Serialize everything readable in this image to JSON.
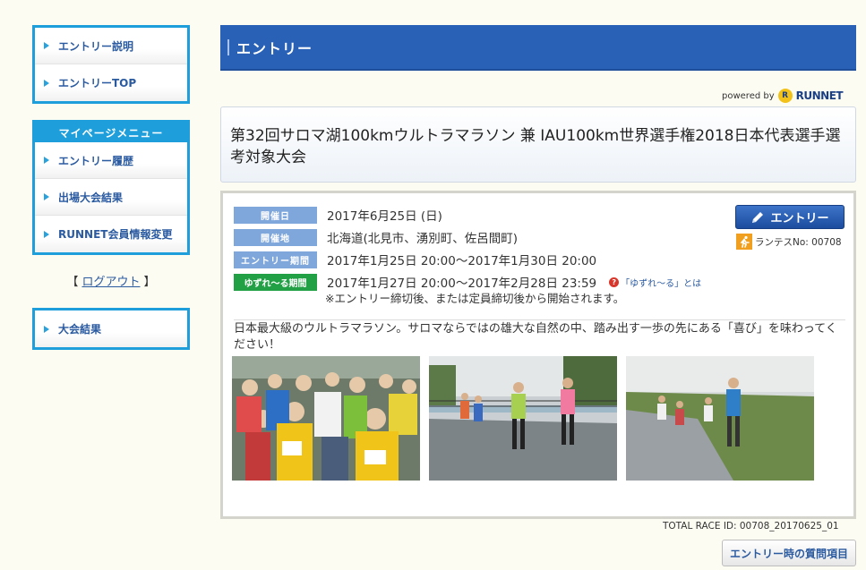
{
  "sidebar": {
    "entry_box": {
      "items": [
        {
          "label": "エントリー説明"
        },
        {
          "label": "エントリーTOP"
        }
      ]
    },
    "mypage_box": {
      "heading": "マイページメニュー",
      "items": [
        {
          "label": "エントリー履歴"
        },
        {
          "label": "出場大会結果"
        },
        {
          "label": "RUNNET会員情報変更"
        }
      ]
    },
    "logout": {
      "open": "【",
      "label": "ログアウト",
      "close": "】"
    },
    "results_box": {
      "items": [
        {
          "label": "大会結果"
        }
      ]
    }
  },
  "header": {
    "title": "エントリー"
  },
  "powered": {
    "prefix": "powered by",
    "brand": "RUNNET"
  },
  "race": {
    "title": "第32回サロマ湖100kmウルトラマラソン 兼 IAU100km世界選手権2018日本代表選手選考対象大会"
  },
  "info": {
    "rows": [
      {
        "badge": "開催日",
        "value": "2017年6月25日 (日)"
      },
      {
        "badge": "開催地",
        "value": "北海道(北見市、湧別町、佐呂間町)"
      },
      {
        "badge": "エントリー期間",
        "value": "2017年1月25日 20:00〜2017年1月30日 20:00"
      },
      {
        "badge": "ゆずれ〜る期間",
        "value": "2017年1月27日 20:00〜2017年2月28日 23:59"
      }
    ],
    "help_link": "「ゆずれ〜る」とは",
    "note": "※エントリー締切後、または定員締切後から開始されます。",
    "entry_button": "エントリー",
    "runtes_label": "ランテスNo: 00708",
    "description": "日本最大級のウルトラマラソン。サロマならではの雄大な自然の中、踏み出す一歩の先にある「喜び」を味わってください！"
  },
  "footer": {
    "total_race_id": "TOTAL RACE ID: 00708_20170625_01",
    "question_button": "エントリー時の質問項目"
  },
  "colors": {
    "accent": "#1e9fdc",
    "header": "#2861b6",
    "badge_blue": "#7fa7db",
    "badge_green": "#22a046"
  }
}
